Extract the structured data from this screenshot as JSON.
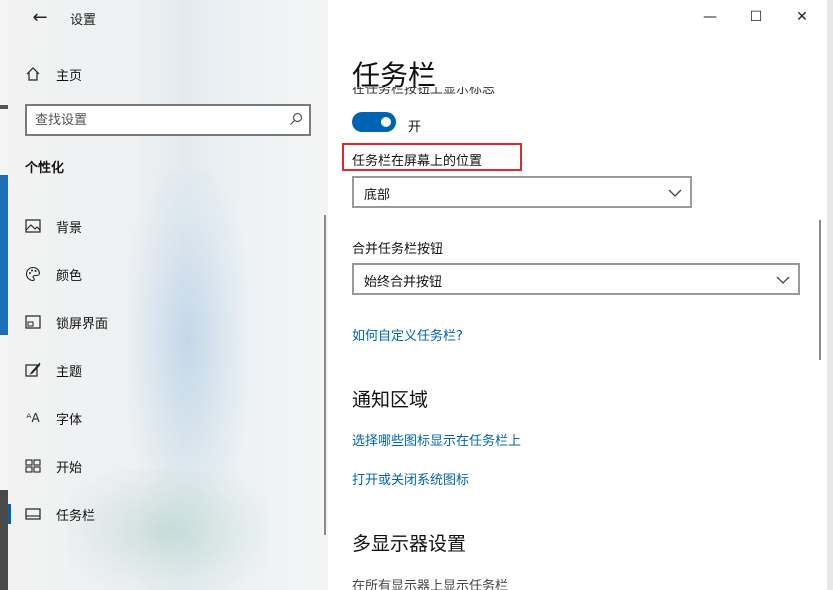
{
  "window": {
    "app_title": "设置",
    "controls": {
      "minimize": "—",
      "maximize": "☐",
      "close": "✕"
    }
  },
  "sidebar": {
    "back_icon": "back-arrow-icon",
    "home": {
      "label": "主页",
      "icon": "home-icon"
    },
    "search": {
      "placeholder": "查找设置",
      "icon": "search-icon"
    },
    "section_title": "个性化",
    "items": [
      {
        "label": "背景",
        "icon": "picture-icon",
        "selected": false
      },
      {
        "label": "颜色",
        "icon": "palette-icon",
        "selected": false
      },
      {
        "label": "锁屏界面",
        "icon": "lockscreen-icon",
        "selected": false
      },
      {
        "label": "主题",
        "icon": "theme-icon",
        "selected": false
      },
      {
        "label": "字体",
        "icon": "font-icon",
        "selected": false
      },
      {
        "label": "开始",
        "icon": "start-icon",
        "selected": false
      },
      {
        "label": "任务栏",
        "icon": "taskbar-icon",
        "selected": true
      }
    ]
  },
  "main": {
    "page_title": "任务栏",
    "cut_off_text": "在任务栏按钮上显示标志",
    "toggle": {
      "state_label": "开",
      "on": true
    },
    "position": {
      "label": "任务栏在屏幕上的位置",
      "value": "底部"
    },
    "combine": {
      "label": "合并任务栏按钮",
      "value": "始终合并按钮"
    },
    "help_link": "如何自定义任务栏?",
    "notification": {
      "heading": "通知区域",
      "link1": "选择哪些图标显示在任务栏上",
      "link2": "打开或关闭系统图标"
    },
    "multi_display": {
      "heading": "多显示器设置",
      "cut_off_text": "在所有显示器上显示任务栏"
    }
  },
  "colors": {
    "accent": "#0063b1",
    "highlight": "#e0282e"
  }
}
